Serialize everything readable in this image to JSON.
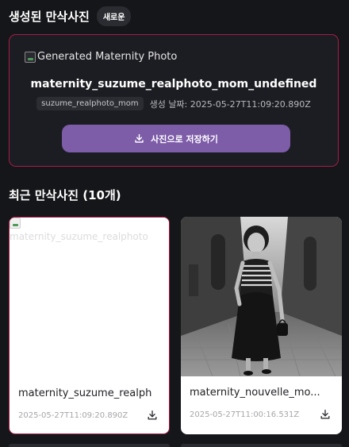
{
  "header": {
    "title": "생성된 만삭사진",
    "badge": "새로운"
  },
  "hero": {
    "image_alt": "Generated Maternity Photo",
    "name": "maternity_suzume_realphoto_mom_undefined",
    "tag": "suzume_realphoto_mom",
    "created_label": "생성 날짜: 2025-05-27T11:09:20.890Z",
    "save_label": "사진으로 저장하기"
  },
  "recent": {
    "title": "최근 만삭사진 (10개)",
    "items": [
      {
        "image_alt": "maternity_suzume_realphoto",
        "name": "maternity_suzume_realph",
        "date": "2025-05-27T11:09:20.890Z",
        "selected": true
      },
      {
        "image_alt": "maternity_nouvelle_mom",
        "name": "maternity_nouvelle_mo...",
        "date": "2025-05-27T11:00:16.531Z",
        "selected": false
      }
    ]
  },
  "colors": {
    "background": "#151619",
    "accent": "#7d5ca8",
    "selected_border": "#a61b45"
  },
  "icons": {
    "save": "download-icon",
    "broken_image": "broken-image-icon"
  }
}
